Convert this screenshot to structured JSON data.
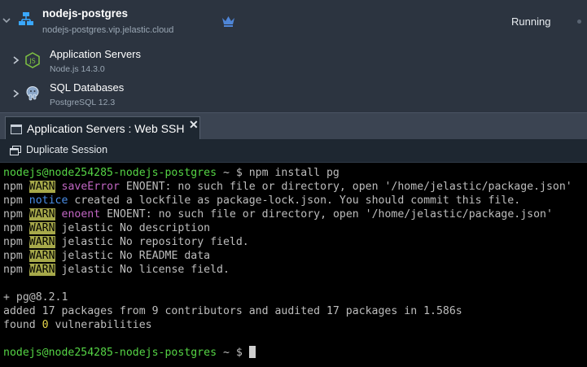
{
  "environment": {
    "name": "nodejs-postgres",
    "url": "nodejs-postgres.vip.jelastic.cloud",
    "status": "Running"
  },
  "nodes": [
    {
      "title": "Application Servers",
      "subtitle": "Node.js 14.3.0",
      "icon": "nodejs-icon"
    },
    {
      "title": "SQL Databases",
      "subtitle": "PostgreSQL 12.3",
      "icon": "postgresql-icon"
    }
  ],
  "tab": {
    "label": "Application Servers : Web SSH",
    "close": "✕"
  },
  "toolbar": {
    "duplicate_label": "Duplicate Session"
  },
  "terminal": {
    "prompt": "nodejs@node254285-nodejs-postgres",
    "prompt_suffix": " ~ $",
    "command": " npm install pg",
    "npm": "npm",
    "warn": "WARN",
    "notice": "notice",
    "lines": [
      {
        "kw": "saveError",
        "rest": " ENOENT: no such file or directory, open '/home/jelastic/package.json'"
      },
      {
        "rest": " created a lockfile as package-lock.json. You should commit this file."
      },
      {
        "kw": "enoent",
        "rest": " ENOENT: no such file or directory, open '/home/jelastic/package.json'"
      },
      {
        "rest": " jelastic No description"
      },
      {
        "rest": " jelastic No repository field."
      },
      {
        "rest": " jelastic No README data"
      },
      {
        "rest": " jelastic No license field."
      }
    ],
    "installed": "+ pg@8.2.1",
    "added": "added 17 packages from 9 contributors and audited 17 packages in 1.586s",
    "found_prefix": "found ",
    "found_count": "0",
    "found_suffix": " vulnerabilities"
  }
}
